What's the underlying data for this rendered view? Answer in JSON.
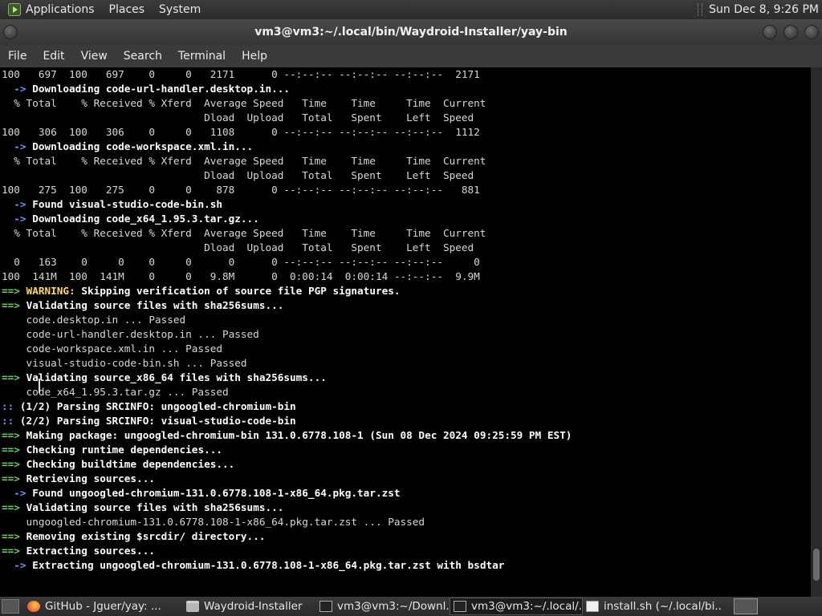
{
  "top_panel": {
    "menus": [
      "Applications",
      "Places",
      "System"
    ],
    "clock": "Sun Dec 8,  9:26 PM"
  },
  "window": {
    "title": "vm3@vm3:~/.local/bin/Waydroid-Installer/yay-bin"
  },
  "menubar": [
    "File",
    "Edit",
    "View",
    "Search",
    "Terminal",
    "Help"
  ],
  "terminal": {
    "lines": [
      [
        {
          "s": "plain",
          "t": "100   697  100   697    0     0   2171      0 --:--:-- --:--:-- --:--:--  2171"
        }
      ],
      [
        {
          "s": "blue",
          "t": "  -> "
        },
        {
          "s": "b",
          "t": "Downloading code-url-handler.desktop.in..."
        }
      ],
      [
        {
          "s": "plain",
          "t": "  % Total    % Received % Xferd  Average Speed   Time    Time     Time  Current"
        }
      ],
      [
        {
          "s": "plain",
          "t": "                                 Dload  Upload   Total   Spent    Left  Speed"
        }
      ],
      [
        {
          "s": "plain",
          "t": "100   306  100   306    0     0   1108      0 --:--:-- --:--:-- --:--:--  1112"
        }
      ],
      [
        {
          "s": "blue",
          "t": "  -> "
        },
        {
          "s": "b",
          "t": "Downloading code-workspace.xml.in..."
        }
      ],
      [
        {
          "s": "plain",
          "t": "  % Total    % Received % Xferd  Average Speed   Time    Time     Time  Current"
        }
      ],
      [
        {
          "s": "plain",
          "t": "                                 Dload  Upload   Total   Spent    Left  Speed"
        }
      ],
      [
        {
          "s": "plain",
          "t": "100   275  100   275    0     0    878      0 --:--:-- --:--:-- --:--:--   881"
        }
      ],
      [
        {
          "s": "blue",
          "t": "  -> "
        },
        {
          "s": "b",
          "t": "Found visual-studio-code-bin.sh"
        }
      ],
      [
        {
          "s": "blue",
          "t": "  -> "
        },
        {
          "s": "b",
          "t": "Downloading code_x64_1.95.3.tar.gz..."
        }
      ],
      [
        {
          "s": "plain",
          "t": "  % Total    % Received % Xferd  Average Speed   Time    Time     Time  Current"
        }
      ],
      [
        {
          "s": "plain",
          "t": "                                 Dload  Upload   Total   Spent    Left  Speed"
        }
      ],
      [
        {
          "s": "plain",
          "t": "  0   163    0     0    0     0      0      0 --:--:-- --:--:-- --:--:--     0"
        }
      ],
      [
        {
          "s": "plain",
          "t": "100  141M  100  141M    0     0   9.8M      0  0:00:14  0:00:14 --:--:--  9.9M"
        }
      ],
      [
        {
          "s": "green",
          "t": "==> "
        },
        {
          "s": "yellow",
          "t": "WARNING: "
        },
        {
          "s": "b",
          "t": "Skipping verification of source file PGP signatures."
        }
      ],
      [
        {
          "s": "green",
          "t": "==> "
        },
        {
          "s": "b",
          "t": "Validating source files with sha256sums..."
        }
      ],
      [
        {
          "s": "plain",
          "t": "    code.desktop.in ... Passed"
        }
      ],
      [
        {
          "s": "plain",
          "t": "    code-url-handler.desktop.in ... Passed"
        }
      ],
      [
        {
          "s": "plain",
          "t": "    code-workspace.xml.in ... Passed"
        }
      ],
      [
        {
          "s": "plain",
          "t": "    visual-studio-code-bin.sh ... Passed"
        }
      ],
      [
        {
          "s": "green",
          "t": "==> "
        },
        {
          "s": "b",
          "t": "Validating source_x86_64 files with sha256sums..."
        }
      ],
      [
        {
          "s": "plain",
          "t": "    code_x64_1.95.3.tar.gz ... Passed"
        }
      ],
      [
        {
          "s": "blue",
          "t": ":: "
        },
        {
          "s": "b",
          "t": "(1/2) Parsing SRCINFO: ungoogled-chromium-bin"
        }
      ],
      [
        {
          "s": "blue",
          "t": ":: "
        },
        {
          "s": "b",
          "t": "(2/2) Parsing SRCINFO: visual-studio-code-bin"
        }
      ],
      [
        {
          "s": "green",
          "t": "==> "
        },
        {
          "s": "b",
          "t": "Making package: ungoogled-chromium-bin 131.0.6778.108-1 (Sun 08 Dec 2024 09:25:59 PM EST)"
        }
      ],
      [
        {
          "s": "green",
          "t": "==> "
        },
        {
          "s": "b",
          "t": "Checking runtime dependencies..."
        }
      ],
      [
        {
          "s": "green",
          "t": "==> "
        },
        {
          "s": "b",
          "t": "Checking buildtime dependencies..."
        }
      ],
      [
        {
          "s": "green",
          "t": "==> "
        },
        {
          "s": "b",
          "t": "Retrieving sources..."
        }
      ],
      [
        {
          "s": "blue",
          "t": "  -> "
        },
        {
          "s": "b",
          "t": "Found ungoogled-chromium-131.0.6778.108-1-x86_64.pkg.tar.zst"
        }
      ],
      [
        {
          "s": "green",
          "t": "==> "
        },
        {
          "s": "b",
          "t": "Validating source files with sha256sums..."
        }
      ],
      [
        {
          "s": "plain",
          "t": "    ungoogled-chromium-131.0.6778.108-1-x86_64.pkg.tar.zst ... Passed"
        }
      ],
      [
        {
          "s": "green",
          "t": "==> "
        },
        {
          "s": "b",
          "t": "Removing existing $srcdir/ directory..."
        }
      ],
      [
        {
          "s": "green",
          "t": "==> "
        },
        {
          "s": "b",
          "t": "Extracting sources..."
        }
      ],
      [
        {
          "s": "blue",
          "t": "  -> "
        },
        {
          "s": "b",
          "t": "Extracting ungoogled-chromium-131.0.6778.108-1-x86_64.pkg.tar.zst with bsdtar"
        }
      ]
    ]
  },
  "taskbar": {
    "tasks": [
      {
        "icon": "firefox-icon",
        "label": "GitHub - Jguer/yay: ...",
        "active": false
      },
      {
        "icon": "folder-icon",
        "label": "Waydroid-Installer",
        "active": false
      },
      {
        "icon": "terminal-icon",
        "label": "vm3@vm3:~/Downl...",
        "active": false
      },
      {
        "icon": "terminal-icon",
        "label": "vm3@vm3:~/.local/...",
        "active": true
      },
      {
        "icon": "text-editor-icon",
        "label": "install.sh (~/.local/bi...",
        "active": false
      }
    ]
  },
  "colors": {
    "prompt_green": "#5fd75f",
    "arrow_blue": "#6f8fff",
    "warning_yellow": "#ffd75f"
  }
}
